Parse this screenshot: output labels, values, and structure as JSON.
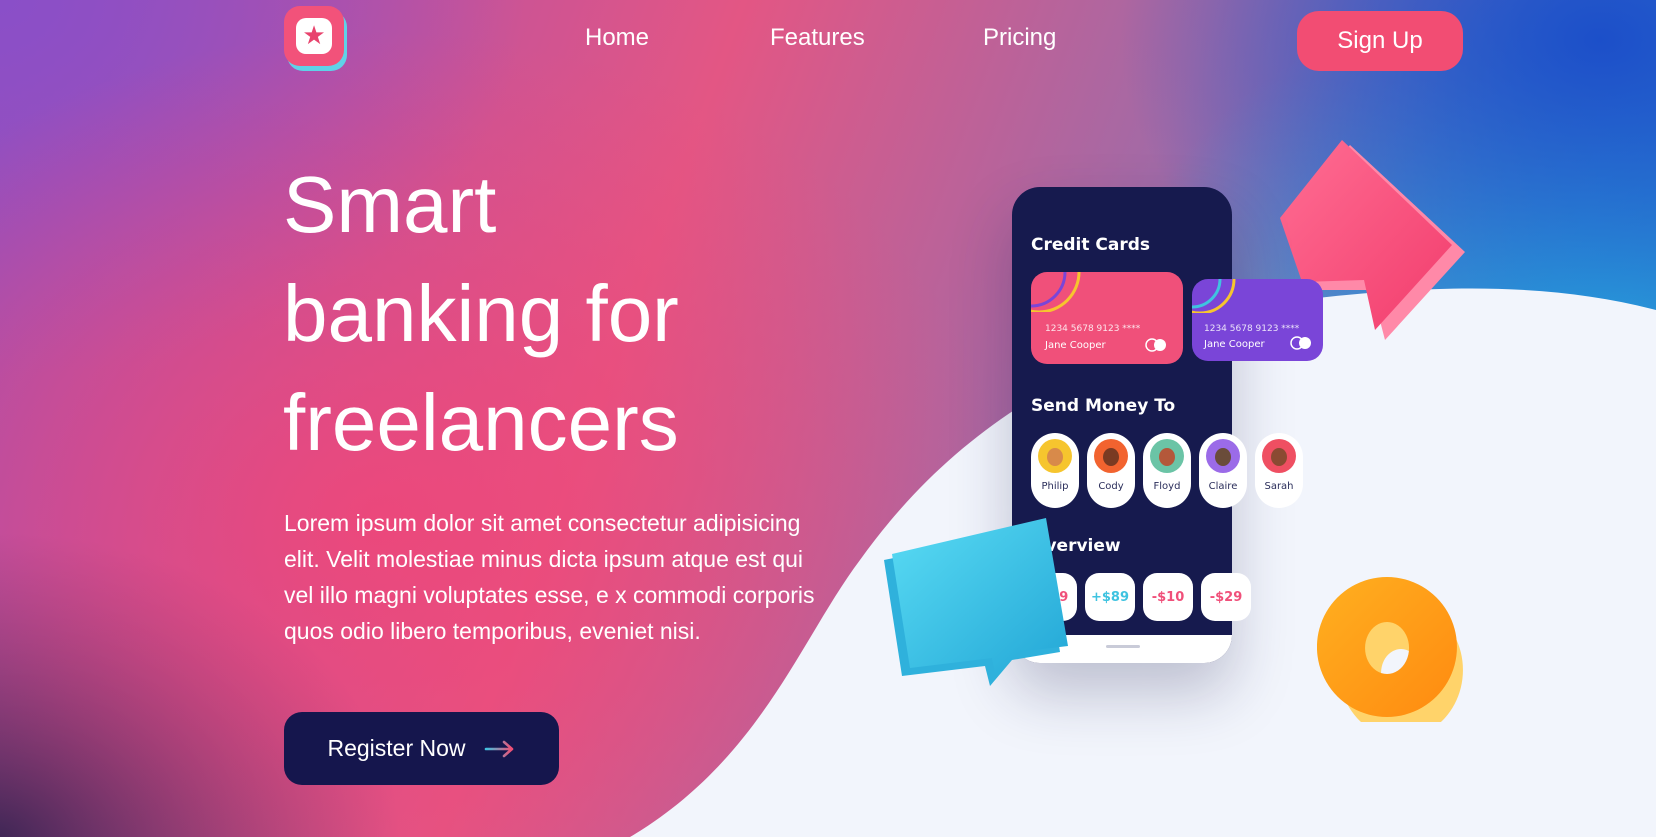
{
  "nav": {
    "links": [
      "Home",
      "Features",
      "Pricing"
    ],
    "signup_label": "Sign Up"
  },
  "hero": {
    "headline_lines": [
      "Smart",
      "banking for",
      "freelancers"
    ],
    "description": "Lorem ipsum dolor sit amet consectetur adipisicing elit. Velit molestiae minus dicta ipsum atque est qui vel illo magni voluptates esse, e x commodi corporis quos odio libero temporibus, eveniet nisi.",
    "register_label": "Register Now"
  },
  "phone": {
    "credit_cards_title": "Credit Cards",
    "cards": [
      {
        "number": "1234 5678 9123 ****",
        "holder": "Jane Cooper",
        "color": "#f0507a"
      },
      {
        "number": "1234 5678 9123 ****",
        "holder": "Jane Cooper",
        "color": "#7a45d8"
      }
    ],
    "send_money_title": "Send Money To",
    "contacts": [
      {
        "name": "Philip",
        "color": "#f6c52e"
      },
      {
        "name": "Cody",
        "color": "#f2632f"
      },
      {
        "name": "Floyd",
        "color": "#6bc4a6"
      },
      {
        "name": "Claire",
        "color": "#9b6be8"
      },
      {
        "name": "Sarah",
        "color": "#ef4f62"
      }
    ],
    "overview_title": "Overview",
    "overview_chips": [
      {
        "value": "-$29",
        "color": "#f0507a"
      },
      {
        "value": "+$89",
        "color": "#3fc3e0"
      },
      {
        "value": "-$10",
        "color": "#f0507a"
      },
      {
        "value": "-$29",
        "color": "#f0507a"
      }
    ]
  },
  "colors": {
    "accent_pink": "#f24d73",
    "navy": "#15164d",
    "cyan": "#3fc3e0",
    "orange": "#ff9a1a"
  },
  "icons": [
    "star-logo-icon",
    "arrow-right-icon"
  ]
}
